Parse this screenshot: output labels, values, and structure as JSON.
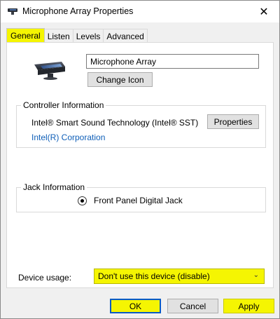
{
  "window": {
    "title": "Microphone Array Properties",
    "close_glyph": "✕"
  },
  "tabs": [
    {
      "label": "General",
      "active": true
    },
    {
      "label": "Listen",
      "active": false
    },
    {
      "label": "Levels",
      "active": false
    },
    {
      "label": "Advanced",
      "active": false
    }
  ],
  "general": {
    "device_name": "Microphone Array",
    "change_icon_label": "Change Icon",
    "controller": {
      "group_label": "Controller Information",
      "name": "Intel® Smart Sound Technology (Intel® SST)",
      "properties_label": "Properties",
      "manufacturer": "Intel(R) Corporation"
    },
    "jack": {
      "group_label": "Jack Information",
      "name": "Front Panel Digital Jack"
    },
    "device_usage": {
      "label": "Device usage:",
      "selected": "Don't use this device (disable)"
    }
  },
  "buttons": {
    "ok": "OK",
    "cancel": "Cancel",
    "apply": "Apply"
  },
  "colors": {
    "highlight": "#f5f502",
    "link": "#0f5fb8",
    "focus_border": "#0a5bc4"
  },
  "icons": {
    "title": "microphone-array-icon",
    "device": "microphone-array-device-icon",
    "close": "close-icon",
    "dropdown": "chevron-down-icon"
  }
}
